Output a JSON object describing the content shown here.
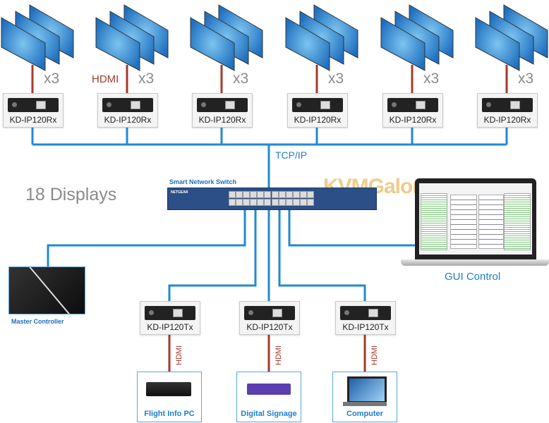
{
  "receivers": [
    {
      "label": "KD-IP120Rx",
      "multiplier": "x3"
    },
    {
      "label": "KD-IP120Rx",
      "multiplier": "x3",
      "cable_label": "HDMI"
    },
    {
      "label": "KD-IP120Rx",
      "multiplier": "x3"
    },
    {
      "label": "KD-IP120Rx",
      "multiplier": "x3"
    },
    {
      "label": "KD-IP120Rx",
      "multiplier": "x3"
    },
    {
      "label": "KD-IP120Rx",
      "multiplier": "x3"
    }
  ],
  "network_label": "TCP/IP",
  "displays_count": "18 Displays",
  "switch": {
    "label": "Smart Network Switch",
    "brand": "NETGEAR"
  },
  "watermark": "KVMGalore",
  "master_controller": {
    "label": "Master Controller"
  },
  "gui": {
    "label": "GUI Control"
  },
  "transmitters": [
    {
      "label": "KD-IP120Tx",
      "cable_label": "HDMI",
      "source": "Flight Info PC"
    },
    {
      "label": "KD-IP120Tx",
      "cable_label": "HDMI",
      "source": "Digital Signage"
    },
    {
      "label": "KD-IP120Tx",
      "cable_label": "HDMI",
      "source": "Computer"
    }
  ],
  "colors": {
    "network": "#1f8ad6",
    "hdmi": "#a33a2a",
    "monitor": "#2a7cc7",
    "label_blue": "#1d7fcf"
  }
}
